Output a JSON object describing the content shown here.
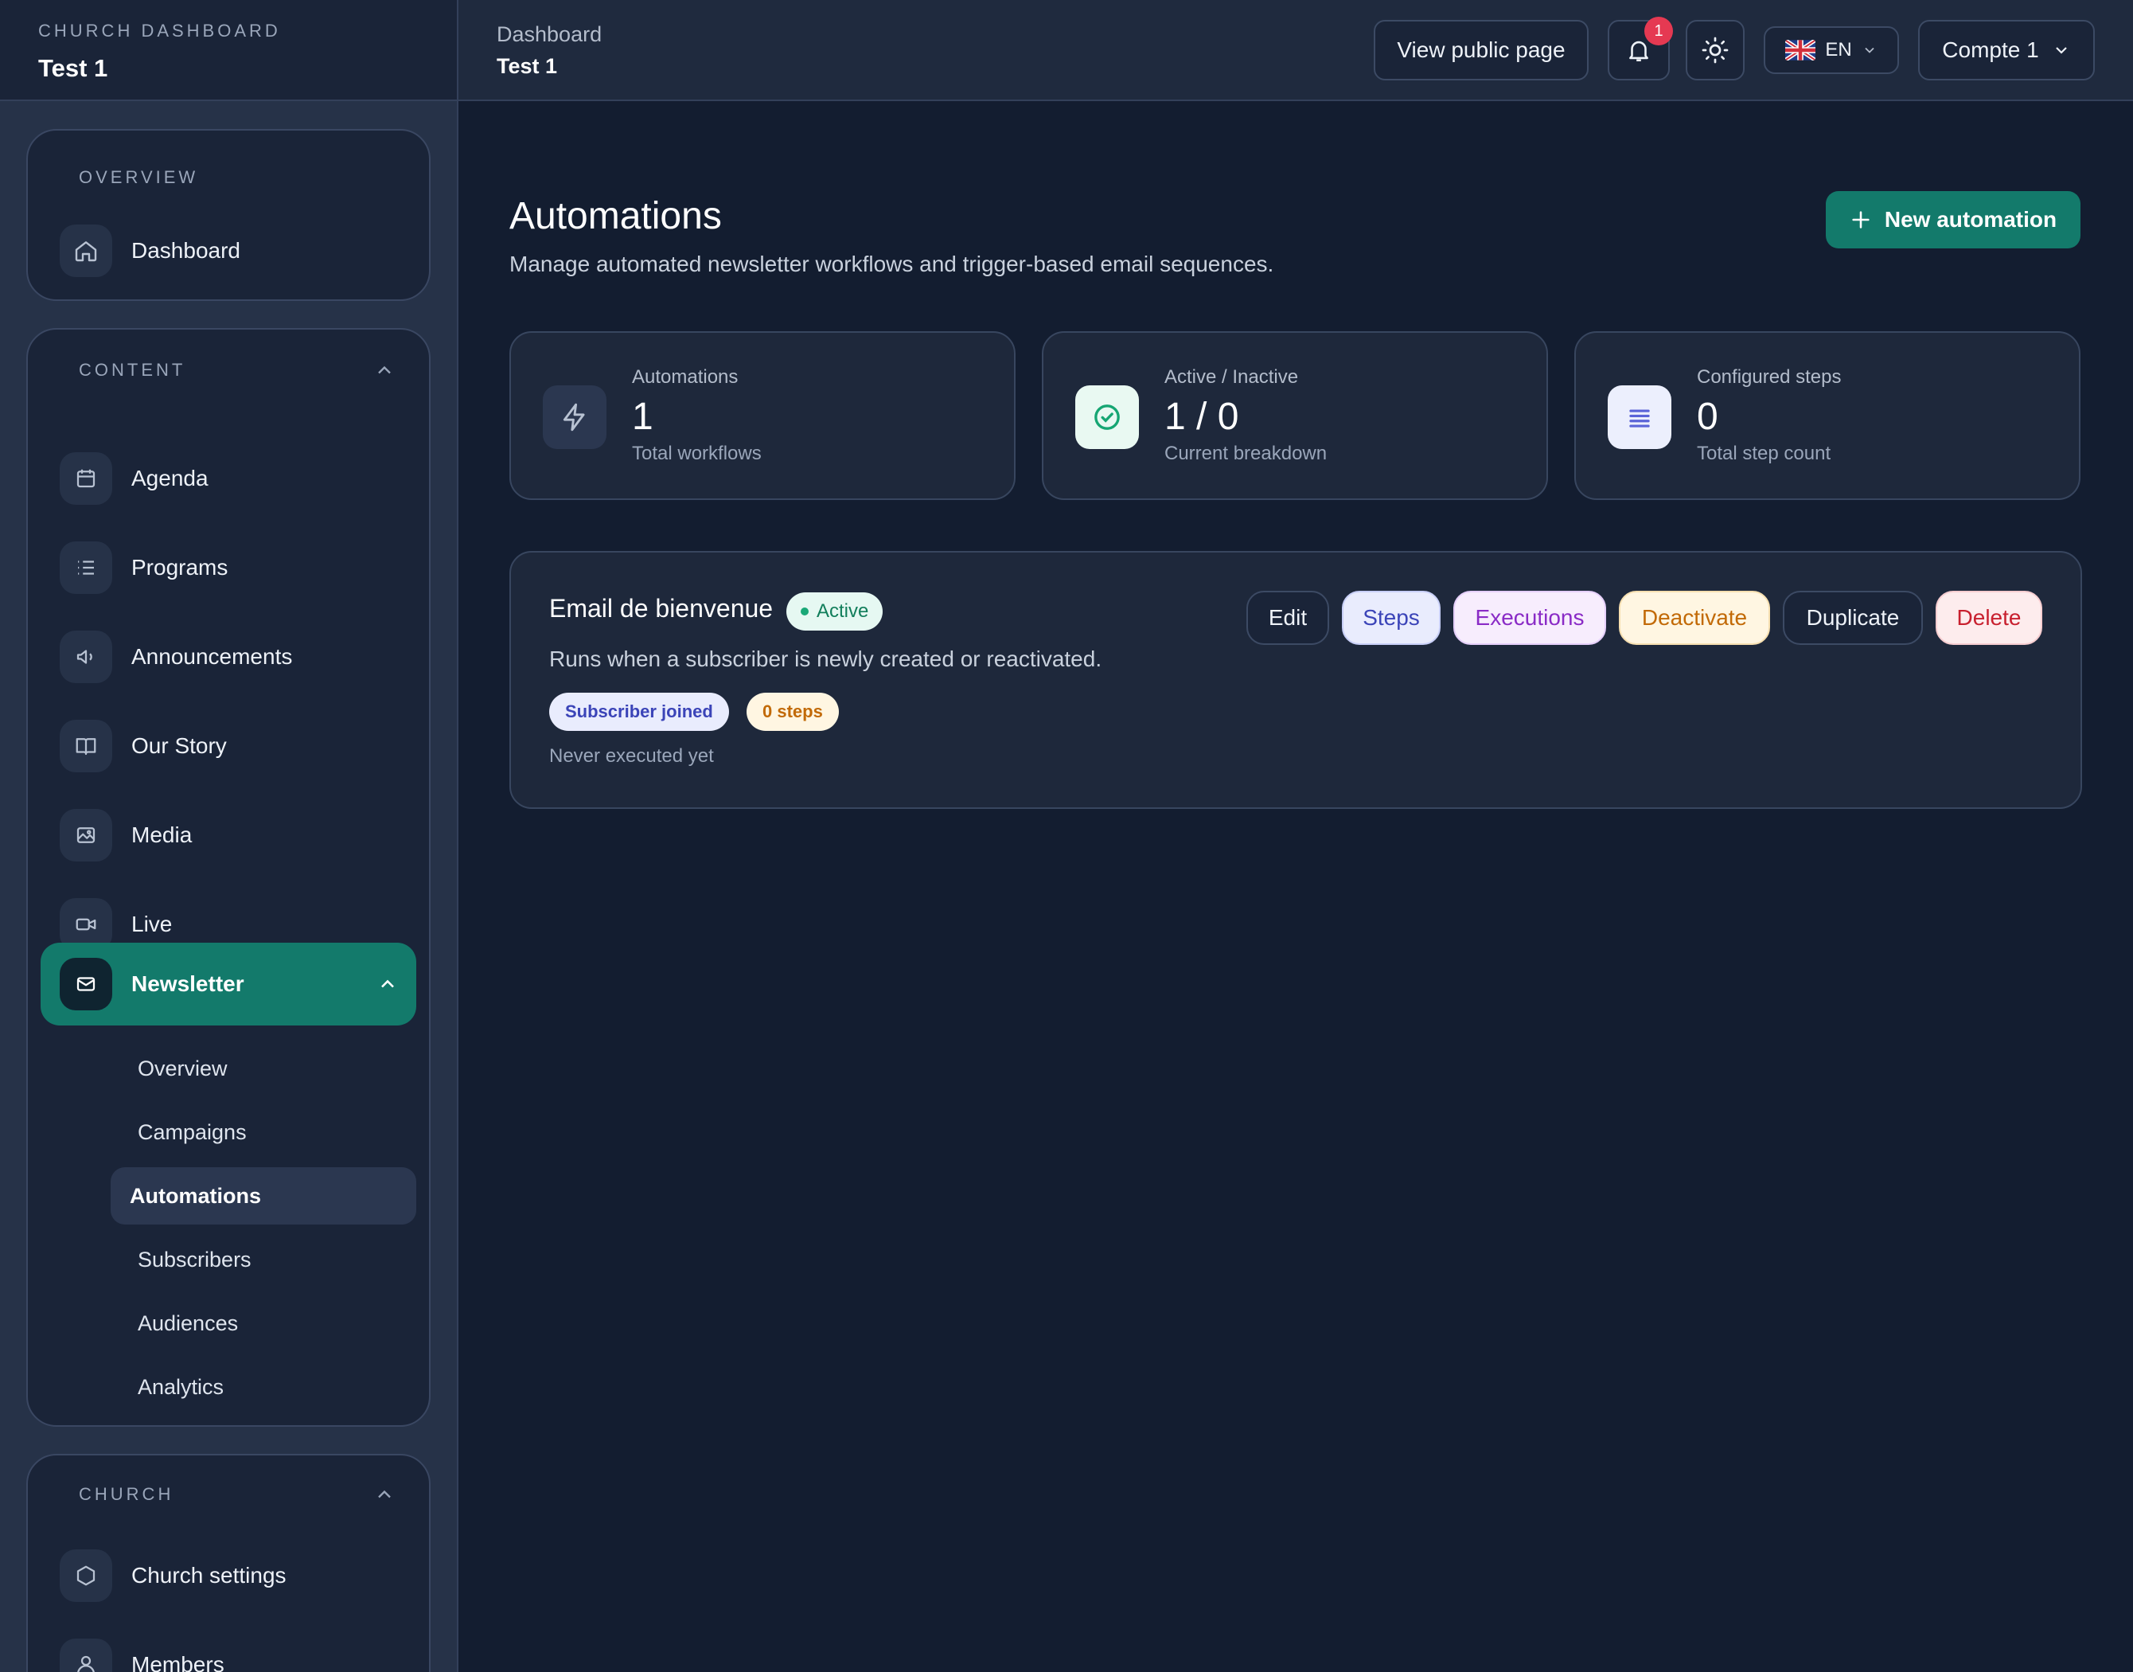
{
  "sidebar": {
    "brand_kicker": "CHURCH DASHBOARD",
    "brand_title": "Test 1",
    "overview": {
      "title": "OVERVIEW",
      "items": [
        {
          "label": "Dashboard",
          "icon": "home-icon"
        }
      ]
    },
    "content": {
      "title": "CONTENT",
      "items": [
        {
          "label": "Agenda",
          "icon": "calendar-icon"
        },
        {
          "label": "Programs",
          "icon": "list-icon"
        },
        {
          "label": "Announcements",
          "icon": "megaphone-icon"
        },
        {
          "label": "Our Story",
          "icon": "book-icon"
        },
        {
          "label": "Media",
          "icon": "image-icon"
        },
        {
          "label": "Live",
          "icon": "video-icon"
        },
        {
          "label": "Newsletter",
          "icon": "mail-icon",
          "active": true
        }
      ],
      "newsletter_sub": [
        {
          "label": "Overview"
        },
        {
          "label": "Campaigns"
        },
        {
          "label": "Automations",
          "active": true
        },
        {
          "label": "Subscribers"
        },
        {
          "label": "Audiences"
        },
        {
          "label": "Analytics"
        }
      ]
    },
    "church": {
      "title": "CHURCH",
      "items": [
        {
          "label": "Church settings",
          "icon": "hexagon-icon"
        },
        {
          "label": "Members",
          "icon": "user-icon"
        }
      ]
    }
  },
  "topbar": {
    "breadcrumb_parent": "Dashboard",
    "breadcrumb_current": "Test 1",
    "view_public_label": "View public page",
    "notification_count": "1",
    "language": "EN",
    "account_label": "Compte 1"
  },
  "page": {
    "title": "Automations",
    "subtitle": "Manage automated newsletter workflows and trigger-based email sequences.",
    "new_button_label": "New automation"
  },
  "stats": [
    {
      "label": "Automations",
      "value": "1",
      "note": "Total workflows",
      "icon": "bolt-icon"
    },
    {
      "label": "Active / Inactive",
      "value": "1 / 0",
      "note": "Current breakdown",
      "icon": "check-circle-icon"
    },
    {
      "label": "Configured steps",
      "value": "0",
      "note": "Total step count",
      "icon": "lines-icon"
    }
  ],
  "automation": {
    "name": "Email de bienvenue",
    "status": "Active",
    "description": "Runs when a subscriber is newly created or reactivated.",
    "trigger_tag": "Subscriber joined",
    "steps_tag": "0 steps",
    "meta": "Never executed yet",
    "actions": {
      "edit": "Edit",
      "steps": "Steps",
      "executions": "Executions",
      "deactivate": "Deactivate",
      "duplicate": "Duplicate",
      "delete": "Delete"
    }
  },
  "colors": {
    "accent": "#137a6b",
    "background": "#131d30",
    "sidebar": "#263248",
    "danger_badge": "#e53952"
  }
}
